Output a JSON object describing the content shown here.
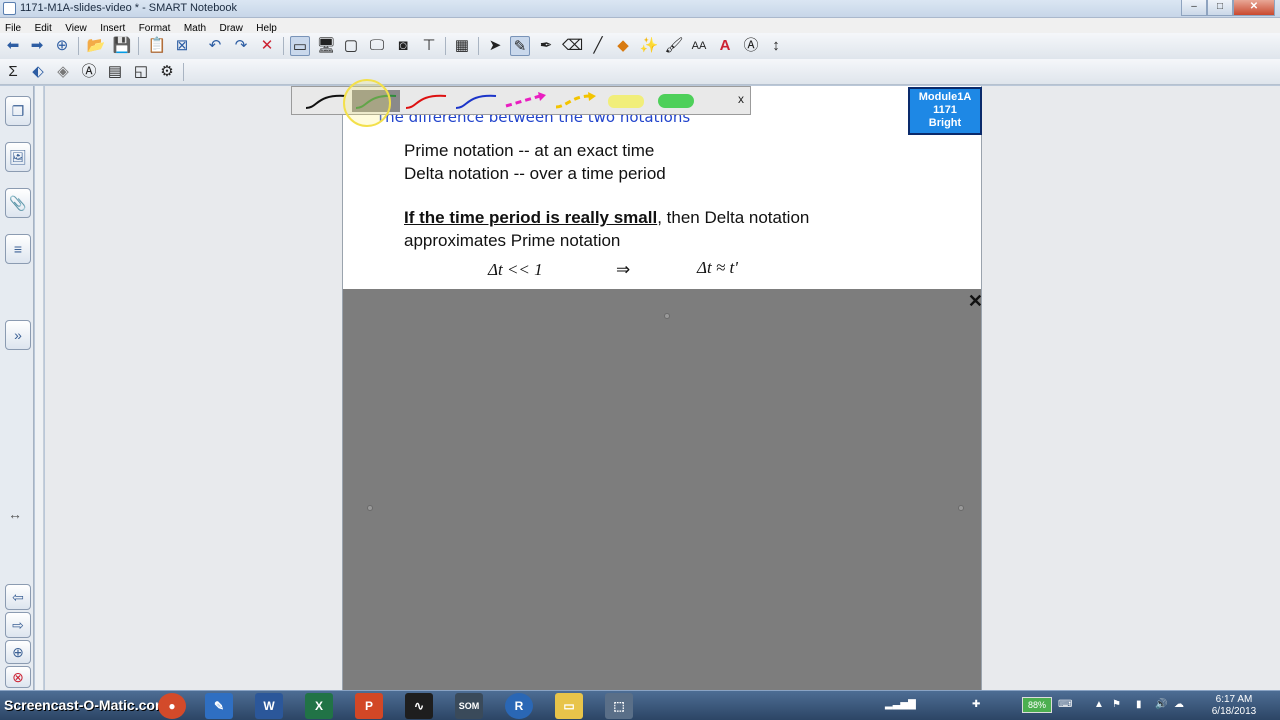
{
  "window": {
    "title": "1171-M1A-slides-video * - SMART Notebook"
  },
  "menu": [
    "File",
    "Edit",
    "View",
    "Insert",
    "Format",
    "Math",
    "Draw",
    "Help"
  ],
  "slide": {
    "heading": "The difference between the two notations",
    "line1": "Prime notation -- at an exact time",
    "line2": "Delta notation -- over a time period",
    "line3_bold": "If the time period is really small",
    "line3_rest": ", then Delta notation",
    "line4": "approximates Prime notation",
    "math_left": "Δt << 1",
    "math_arrow": "⇒",
    "math_right": "Δt ≈ t'",
    "badge": [
      "Module1A",
      "1171",
      "Bright"
    ]
  },
  "pen_toolbar": {
    "close": "x"
  },
  "shade": {
    "close": "✕"
  },
  "taskbar": {
    "watermark": "Screencast-O-Matic.com",
    "battery": "88%",
    "time": "6:17 AM",
    "date": "6/18/2013"
  }
}
